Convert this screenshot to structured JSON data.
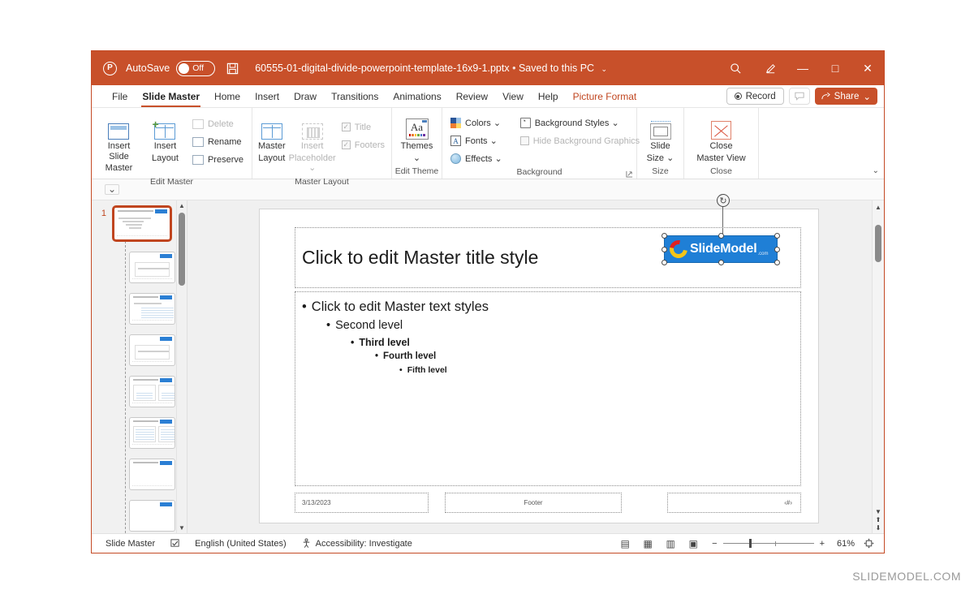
{
  "titlebar": {
    "app_icon": "powerpoint-icon",
    "autosave_label": "AutoSave",
    "autosave_state": "Off",
    "save_icon": "save-icon",
    "document_name": "60555-01-digital-divide-powerpoint-template-16x9-1.pptx",
    "separator": "•",
    "save_location": "Saved to this PC",
    "dropdown_caret": "⌄",
    "search_icon": "search-icon",
    "pen_icon": "pen-annotation-icon",
    "minimize": "—",
    "maximize": "□",
    "close": "✕",
    "bg_color": "#c8502a"
  },
  "tabs": {
    "items": [
      {
        "label": "File",
        "active": false
      },
      {
        "label": "Slide Master",
        "active": true
      },
      {
        "label": "Home",
        "active": false
      },
      {
        "label": "Insert",
        "active": false
      },
      {
        "label": "Draw",
        "active": false
      },
      {
        "label": "Transitions",
        "active": false
      },
      {
        "label": "Animations",
        "active": false
      },
      {
        "label": "Review",
        "active": false
      },
      {
        "label": "View",
        "active": false
      },
      {
        "label": "Help",
        "active": false
      }
    ],
    "contextual": "Picture Format",
    "record_label": "Record",
    "comment_icon": "comment-icon",
    "share_label": "Share",
    "share_caret": "⌄"
  },
  "ribbon": {
    "groups": [
      {
        "name": "Edit Master",
        "label": "Edit Master",
        "big": [
          {
            "label1": "Insert Slide",
            "label2": "Master",
            "icon": "insert-slide-master-icon",
            "disabled": false
          },
          {
            "label1": "Insert",
            "label2": "Layout",
            "icon": "insert-layout-icon",
            "disabled": false
          }
        ],
        "small": [
          {
            "label": "Delete",
            "icon": "delete-icon",
            "disabled": true
          },
          {
            "label": "Rename",
            "icon": "rename-icon",
            "disabled": false
          },
          {
            "label": "Preserve",
            "icon": "preserve-icon",
            "disabled": false
          }
        ]
      },
      {
        "name": "Master Layout",
        "label": "Master Layout",
        "big": [
          {
            "label1": "Master",
            "label2": "Layout",
            "icon": "master-layout-icon",
            "disabled": false
          },
          {
            "label1": "Insert",
            "label2": "Placeholder ⌄",
            "icon": "insert-placeholder-icon",
            "disabled": true
          }
        ],
        "checks": [
          {
            "label": "Title",
            "checked": true,
            "disabled": true
          },
          {
            "label": "Footers",
            "checked": true,
            "disabled": true
          }
        ]
      },
      {
        "name": "Edit Theme",
        "label": "Edit Theme",
        "big": [
          {
            "label1": "Themes",
            "label2": "⌄",
            "icon": "themes-icon",
            "disabled": false
          }
        ]
      },
      {
        "name": "Background",
        "label": "Background",
        "small": [
          {
            "label": "Colors ⌄",
            "icon": "colors-icon",
            "disabled": false
          },
          {
            "label": "Fonts ⌄",
            "icon": "fonts-icon",
            "disabled": false
          },
          {
            "label": "Effects ⌄",
            "icon": "effects-icon",
            "disabled": false
          }
        ],
        "small2": [
          {
            "label": "Background Styles ⌄",
            "icon": "background-styles-icon",
            "disabled": false
          },
          {
            "label": "Hide Background Graphics",
            "icon": "hide-background-graphics-checkbox",
            "disabled": true
          }
        ],
        "launcher": "⌐"
      },
      {
        "name": "Size",
        "label": "Size",
        "big": [
          {
            "label1": "Slide",
            "label2": "Size ⌄",
            "icon": "slide-size-icon",
            "disabled": false
          }
        ]
      },
      {
        "name": "Close",
        "label": "Close",
        "big": [
          {
            "label1": "Close",
            "label2": "Master View",
            "icon": "close-master-view-icon",
            "disabled": false
          }
        ]
      }
    ],
    "collapse_caret": "⌄"
  },
  "underbar": {
    "dropdown_icon": "⌄"
  },
  "thumbnails": {
    "selected_index": 0,
    "items": [
      {
        "number": "1",
        "type": "master",
        "selected": true
      },
      {
        "number": "",
        "type": "layout",
        "selected": false
      },
      {
        "number": "",
        "type": "layout",
        "selected": false
      },
      {
        "number": "",
        "type": "layout",
        "selected": false
      },
      {
        "number": "",
        "type": "layout",
        "selected": false
      },
      {
        "number": "",
        "type": "layout",
        "selected": false
      },
      {
        "number": "",
        "type": "layout",
        "selected": false
      },
      {
        "number": "",
        "type": "layout",
        "selected": false
      }
    ],
    "scroll_up": "▲",
    "scroll_down": "▼"
  },
  "slide": {
    "title_placeholder": "Click to edit Master title style",
    "body_levels": [
      {
        "bullet": "•",
        "text": "Click to edit Master text styles"
      },
      {
        "bullet": "•",
        "text": "Second level"
      },
      {
        "bullet": "•",
        "text": "Third level"
      },
      {
        "bullet": "•",
        "text": "Fourth level"
      },
      {
        "bullet": "•",
        "text": "Fifth level"
      }
    ],
    "date_placeholder": "3/13/2023",
    "footer_placeholder": "Footer",
    "slide_number_placeholder": "‹#›",
    "logo": {
      "name": "slidemodel-logo-picture",
      "text": "SlideModel",
      "suffix": ".com",
      "bg_color": "#1f7fd6",
      "selected": true
    },
    "rotation_handle": "↻"
  },
  "scrollbar": {
    "up": "▲",
    "down": "▼",
    "prev_slide": "⬆",
    "next_slide": "⬇"
  },
  "statusbar": {
    "view_name": "Slide Master",
    "spellcheck_icon": "spellcheck-icon",
    "language": "English (United States)",
    "accessibility_icon": "accessibility-icon",
    "accessibility": "Accessibility: Investigate",
    "views": [
      {
        "name": "normal-view",
        "glyph": "▤",
        "active": false
      },
      {
        "name": "slide-sorter-view",
        "glyph": "▦",
        "active": false
      },
      {
        "name": "reading-view",
        "glyph": "▥",
        "active": false
      },
      {
        "name": "slideshow-view",
        "glyph": "▣",
        "active": false
      }
    ],
    "zoom_out": "−",
    "zoom_in": "+",
    "zoom_level": "61%",
    "fit_slide_icon": "fit-to-window-icon"
  },
  "watermark": {
    "text": "SLIDEMODEL.COM"
  }
}
